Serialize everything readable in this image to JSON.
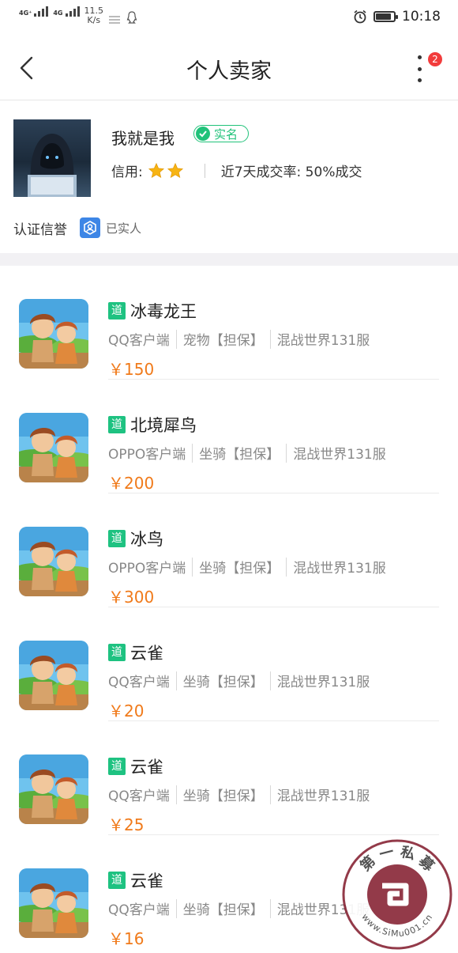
{
  "status_bar": {
    "net1": "4G⁺",
    "net2": "4G",
    "speed_value": "11.5",
    "speed_unit": "K/s",
    "time": "10:18",
    "battery_level": 0.8
  },
  "header": {
    "title": "个人卖家",
    "badge_count": "2"
  },
  "seller": {
    "name": "我就是我",
    "verified_label": "实名",
    "credit_label": "信用:",
    "credit_stars": 2,
    "deal_rate": "近7天成交率: 50%成交",
    "cert_label": "认证信誉",
    "cert_value": "已实人"
  },
  "listings": [
    {
      "tag": "道",
      "title": "冰毒龙王",
      "client": "QQ客户端",
      "category": "宠物【担保】",
      "server": "混战世界131服",
      "price": "￥150"
    },
    {
      "tag": "道",
      "title": "北境犀鸟",
      "client": "OPPO客户端",
      "category": "坐骑【担保】",
      "server": "混战世界131服",
      "price": "￥200"
    },
    {
      "tag": "道",
      "title": "冰鸟",
      "client": "OPPO客户端",
      "category": "坐骑【担保】",
      "server": "混战世界131服",
      "price": "￥300"
    },
    {
      "tag": "道",
      "title": "云雀",
      "client": "QQ客户端",
      "category": "坐骑【担保】",
      "server": "混战世界131服",
      "price": "￥20"
    },
    {
      "tag": "道",
      "title": "云雀",
      "client": "QQ客户端",
      "category": "坐骑【担保】",
      "server": "混战世界131服",
      "price": "￥25"
    },
    {
      "tag": "道",
      "title": "云雀",
      "client": "QQ客户端",
      "category": "坐骑【担保】",
      "server": "混战世界131服",
      "price": "￥16"
    }
  ],
  "watermark": {
    "text_top": "第一私募",
    "text_bottom": "www.SiMu001.cn"
  },
  "colors": {
    "accent_green": "#1ec281",
    "price_orange": "#f07a1a",
    "badge_red": "#f23c3c",
    "cert_blue": "#3d86e6"
  }
}
